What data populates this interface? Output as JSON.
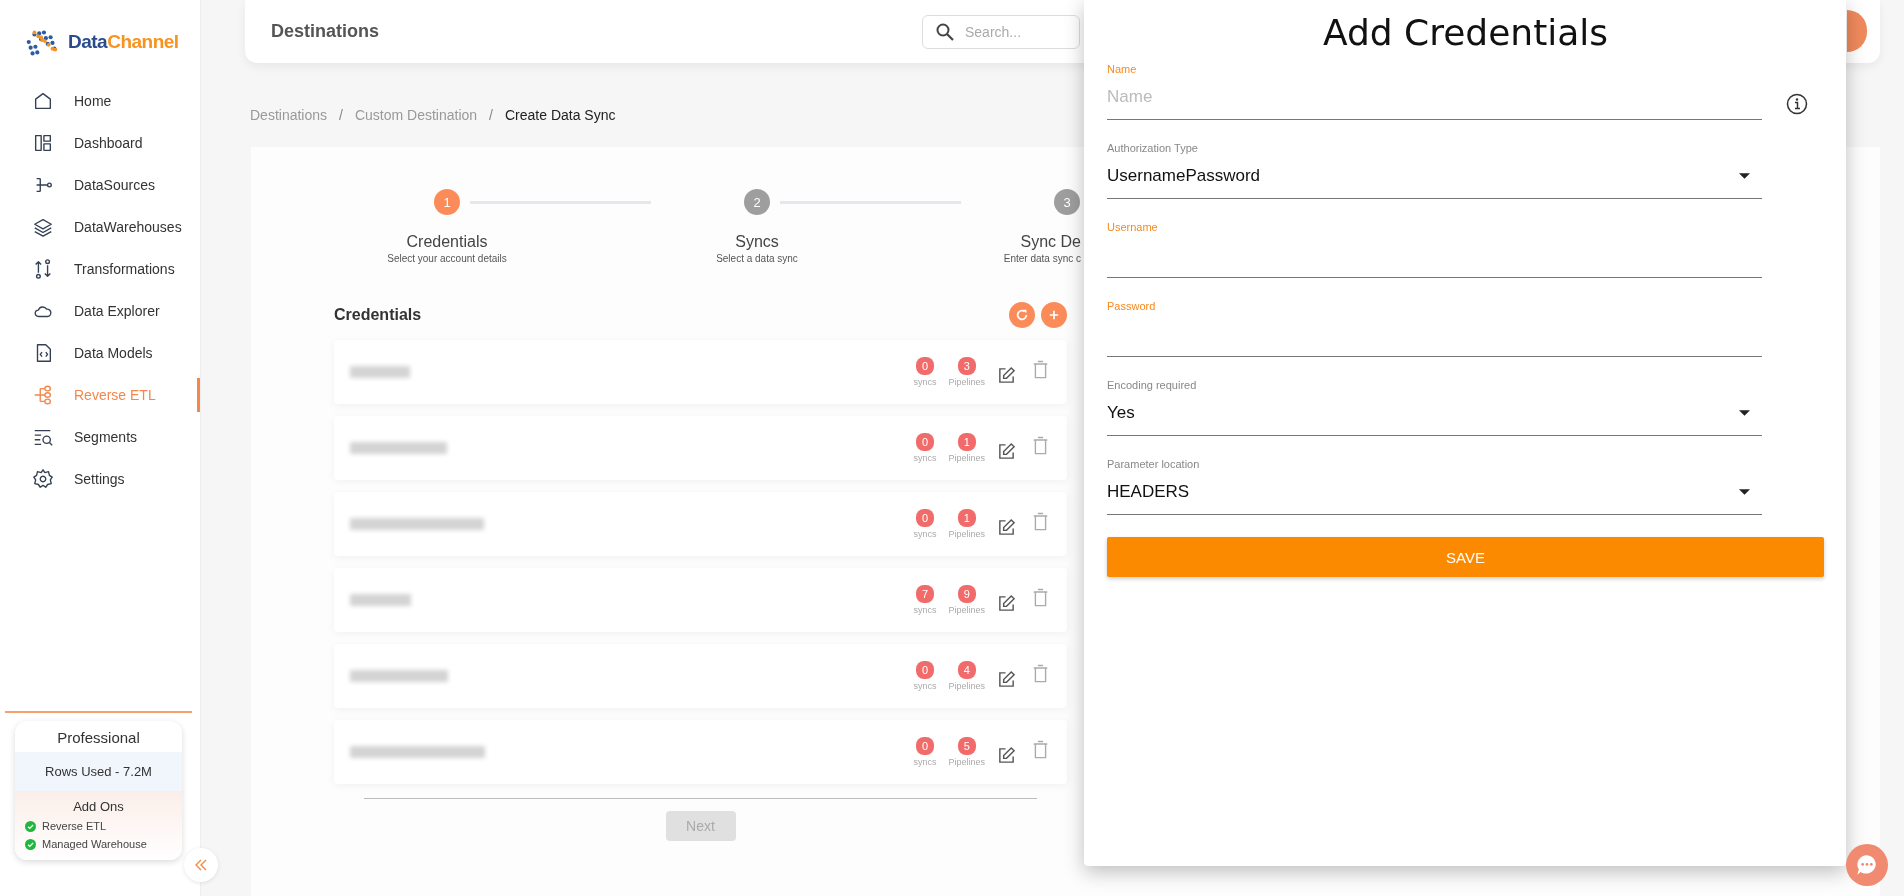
{
  "logo": {
    "part_1": "Data",
    "part_2": "Channel"
  },
  "sidebar": {
    "items": [
      {
        "label": "Home",
        "selected": false
      },
      {
        "label": "Dashboard",
        "selected": false
      },
      {
        "label": "DataSources",
        "selected": false
      },
      {
        "label": "DataWarehouses",
        "selected": false
      },
      {
        "label": "Transformations",
        "selected": false
      },
      {
        "label": "Data Explorer",
        "selected": false
      },
      {
        "label": "Data Models",
        "selected": false
      },
      {
        "label": "Reverse ETL",
        "selected": true
      },
      {
        "label": "Segments",
        "selected": false
      },
      {
        "label": "Settings",
        "selected": false
      }
    ],
    "plan": {
      "title": "Professional",
      "rows_used": "Rows Used - 7.2M",
      "addons_title": "Add Ons",
      "addons": [
        "Reverse ETL",
        "Managed Warehouse"
      ]
    }
  },
  "header": {
    "title": "Destinations",
    "search": {
      "placeholder": "Search..."
    }
  },
  "breadcrumb": {
    "separator": "/",
    "items": [
      {
        "label": "Destinations",
        "current": false
      },
      {
        "label": "Custom Destination",
        "current": false
      },
      {
        "label": "Create Data Sync",
        "current": true
      }
    ]
  },
  "steps": [
    {
      "number": "1",
      "title": "Credentials",
      "subtitle": "Select your account details",
      "active": true
    },
    {
      "number": "2",
      "title": "Syncs",
      "subtitle": "Select a data sync",
      "active": false
    },
    {
      "number": "3",
      "title": "Sync De",
      "subtitle": "Enter data sync c",
      "active": false
    }
  ],
  "credentials": {
    "title": "Credentials",
    "rows": [
      {
        "syncs": "0",
        "syncs_label": "syncs",
        "pipelines": "3",
        "pipelines_label": "Pipelines"
      },
      {
        "syncs": "0",
        "syncs_label": "syncs",
        "pipelines": "1",
        "pipelines_label": "Pipelines"
      },
      {
        "syncs": "0",
        "syncs_label": "syncs",
        "pipelines": "1",
        "pipelines_label": "Pipelines"
      },
      {
        "syncs": "7",
        "syncs_label": "syncs",
        "pipelines": "9",
        "pipelines_label": "Pipelines"
      },
      {
        "syncs": "0",
        "syncs_label": "syncs",
        "pipelines": "4",
        "pipelines_label": "Pipelines"
      },
      {
        "syncs": "0",
        "syncs_label": "syncs",
        "pipelines": "5",
        "pipelines_label": "Pipelines"
      }
    ]
  },
  "next_button": "Next",
  "panel": {
    "title": "Add Credentials",
    "fields": [
      {
        "kind": "text",
        "label": "Name",
        "placeholder": "Name",
        "required": true
      },
      {
        "kind": "select",
        "label": "Authorization Type",
        "value": "UsernamePassword",
        "required": false
      },
      {
        "kind": "text",
        "label": "Username",
        "required": true
      },
      {
        "kind": "text",
        "label": "Password",
        "required": true
      },
      {
        "kind": "select",
        "label": "Encoding required",
        "value": "Yes",
        "required": false
      },
      {
        "kind": "select",
        "label": "Parameter location",
        "value": "HEADERS",
        "required": false
      }
    ],
    "save_button": "SAVE"
  }
}
